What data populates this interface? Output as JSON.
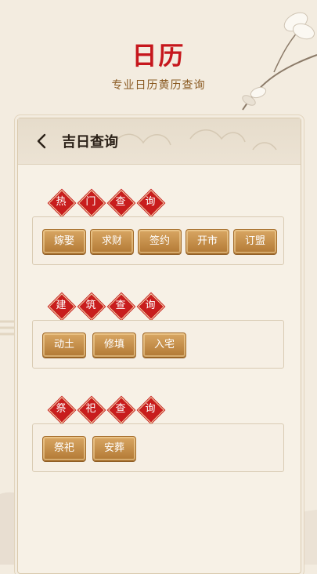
{
  "header": {
    "app_title": "日历",
    "app_subtitle": "专业日历黄历查询"
  },
  "page": {
    "back_icon": "chevron-left-icon",
    "title": "吉日查询"
  },
  "sections": [
    {
      "badges": [
        "热",
        "门",
        "查",
        "询"
      ],
      "tags": [
        "嫁娶",
        "求财",
        "签约",
        "开市",
        "订盟"
      ]
    },
    {
      "badges": [
        "建",
        "筑",
        "查",
        "询"
      ],
      "tags": [
        "动土",
        "修填",
        "入宅"
      ]
    },
    {
      "badges": [
        "祭",
        "祀",
        "查",
        "询"
      ],
      "tags": [
        "祭祀",
        "安葬"
      ]
    }
  ],
  "colors": {
    "title_red": "#c6171d",
    "badge_red": "#c81d1d",
    "tag_gold": "#c58c45",
    "subtitle_brown": "#8a5a22"
  }
}
